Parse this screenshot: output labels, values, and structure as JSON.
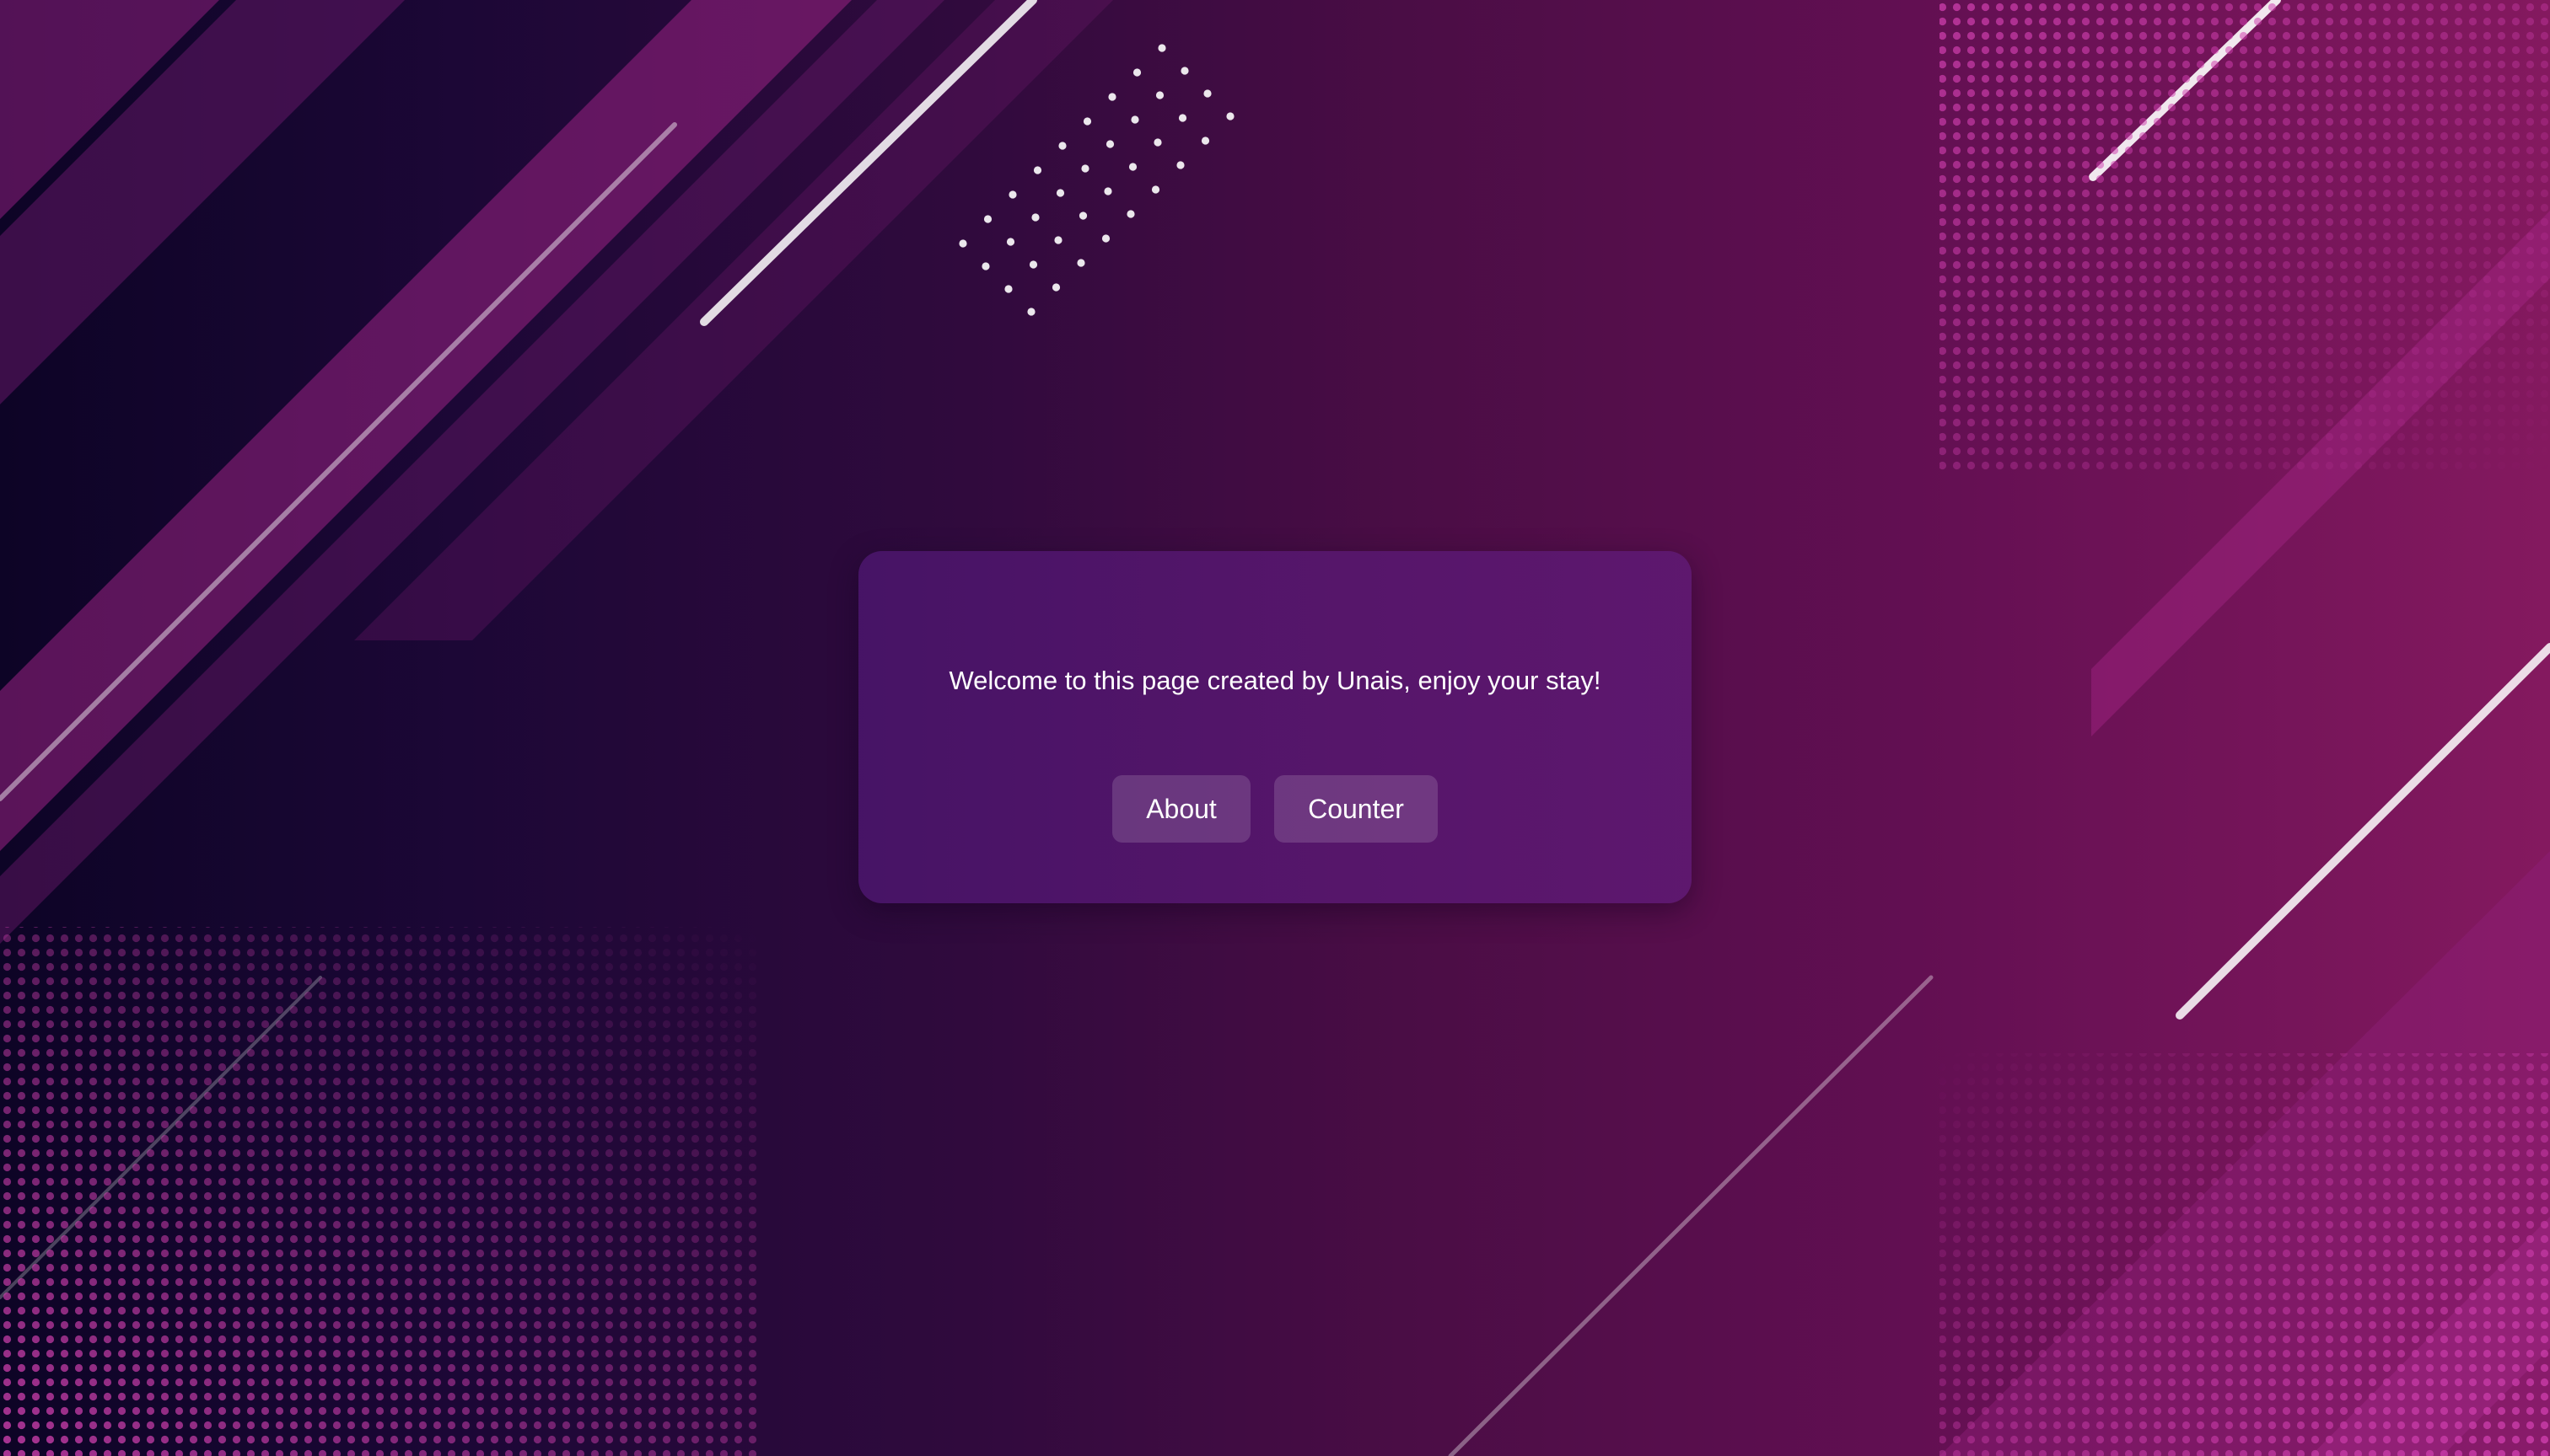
{
  "page": {
    "welcome_message": "Welcome to this page created by Unais, enjoy your stay!"
  },
  "nav": {
    "about_label": "About",
    "counter_label": "Counter"
  },
  "theme": {
    "card_color": "#4f1470",
    "button_color": "#6e3a8a",
    "text_color": "#ffffff",
    "accent_pink": "#c23aa3"
  }
}
